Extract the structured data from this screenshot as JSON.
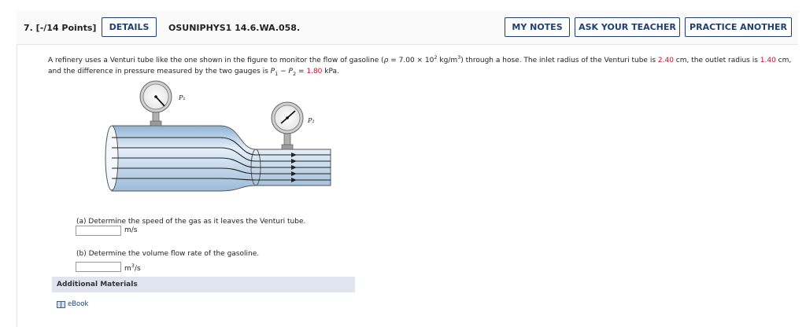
{
  "question": {
    "number_label": "7. [-/14 Points]",
    "details_label": "DETAILS",
    "code": "OSUNIPHYS1 14.6.WA.058.",
    "my_notes_label": "MY NOTES",
    "ask_teacher_label": "ASK YOUR TEACHER",
    "practice_label": "PRACTICE ANOTHER"
  },
  "problem": {
    "t1": "A refinery uses a Venturi tube like the one shown in the figure to monitor the flow of gasoline (",
    "rho_sym": "ρ",
    "t2": " = 7.00 × 10",
    "exp": "2",
    "t3": " kg/m",
    "exp3": "3",
    "t4": ") through a hose. The inlet radius of the Venturi tube is ",
    "inlet_radius": "2.40",
    "t5": " cm, the outlet radius is ",
    "outlet_radius": "1.40",
    "t6": " cm, and the difference in pressure measured by the two gauges is ",
    "p": "P",
    "sub1": "1",
    "minus": " − ",
    "sub2": "2",
    "t7": " = ",
    "pressure_diff": "1.80",
    "t8": " kPa."
  },
  "figure": {
    "gauge1_label": "P₁",
    "gauge2_label": "P₂"
  },
  "part_a": {
    "prompt": "(a) Determine the speed of the gas as it leaves the Venturi tube.",
    "value": "",
    "unit": "m/s"
  },
  "part_b": {
    "prompt": "(b) Determine the volume flow rate of the gasoline.",
    "value": "",
    "unit_base": "m",
    "unit_exp": "3",
    "unit_tail": "/s"
  },
  "additional": {
    "title": "Additional Materials",
    "ebook_label": "eBook"
  },
  "colors": {
    "accent": "#1f3f6e",
    "highlight": "#c8102e",
    "additional_bg": "#dfe4ee"
  }
}
